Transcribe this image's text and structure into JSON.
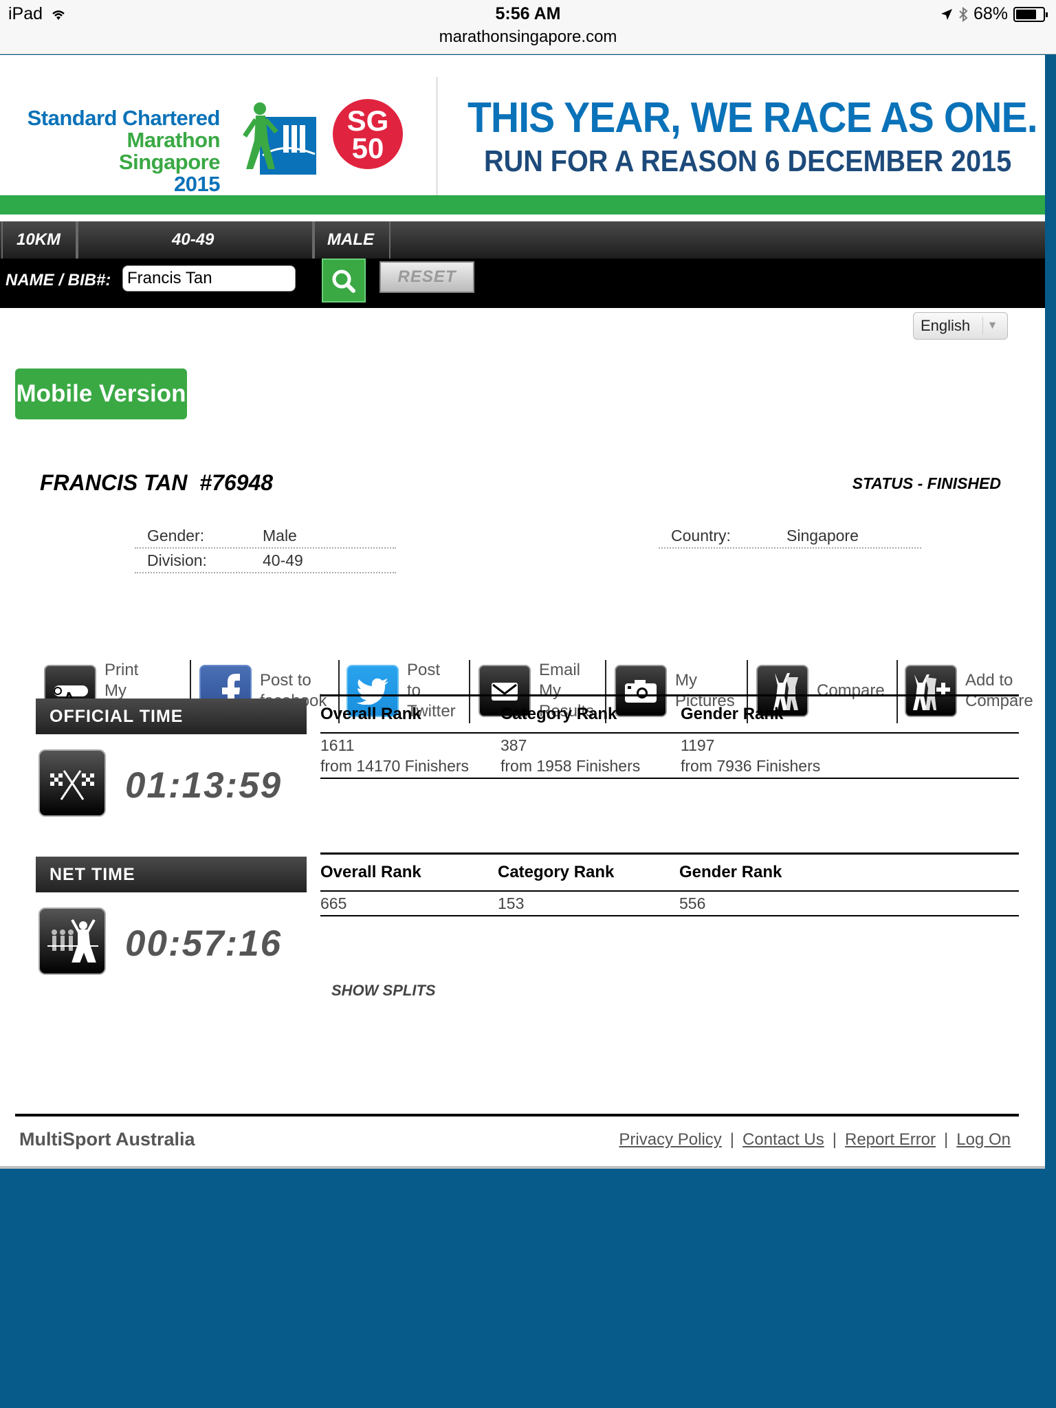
{
  "status_bar": {
    "device": "iPad",
    "time": "5:56 AM",
    "url": "marathonsingapore.com",
    "battery": "68%"
  },
  "banner": {
    "logo_line1": "Standard Chartered",
    "logo_line2": "Marathon Singapore",
    "logo_line3": "2015",
    "badge_line1": "SG",
    "badge_line2": "50",
    "slogan_line1": "THIS YEAR, WE RACE AS ONE.",
    "slogan_line2": "RUN FOR A REASON  6 DECEMBER 2015"
  },
  "filters": {
    "distance": "10KM",
    "age_group": "40-49",
    "gender": "MALE"
  },
  "search": {
    "label": "NAME / BIB#:",
    "value": "Francis Tan",
    "reset_label": "RESET"
  },
  "language": {
    "selected": "English"
  },
  "mobile_version_label": "Mobile Version",
  "runner": {
    "name": "FRANCIS TAN  #76948",
    "status": "STATUS - FINISHED"
  },
  "info": {
    "gender_label": "Gender:",
    "gender_value": "Male",
    "division_label": "Division:",
    "division_value": "40-49",
    "country_label": "Country:",
    "country_value": "Singapore"
  },
  "actions": [
    {
      "label": "Print\nMy\nCertificate",
      "icon": "certificate-icon"
    },
    {
      "label": "Post to\nfacebook",
      "icon": "facebook-icon"
    },
    {
      "label": "Post\nto\nTwitter",
      "icon": "twitter-icon"
    },
    {
      "label": "Email\nMy\nResults",
      "icon": "email-icon"
    },
    {
      "label": "My\nPictures",
      "icon": "camera-icon"
    },
    {
      "label": "Compare",
      "icon": "compare-icon"
    },
    {
      "label": "Add to\nCompare",
      "icon": "add-compare-icon"
    }
  ],
  "official": {
    "label": "OFFICIAL TIME",
    "time": "01:13:59",
    "headers": [
      "Overall Rank",
      "Category Rank",
      "Gender Rank"
    ],
    "ranks": [
      "1611",
      "387",
      "1197"
    ],
    "from": [
      "from 14170 Finishers",
      "from 1958 Finishers",
      "from 7936 Finishers"
    ]
  },
  "net": {
    "label": "NET TIME",
    "time": "00:57:16",
    "headers": [
      "Overall Rank",
      "Category Rank",
      "Gender Rank"
    ],
    "ranks": [
      "665",
      "153",
      "556"
    ]
  },
  "show_splits": "SHOW SPLITS",
  "footer": {
    "brand": "MultiSport Australia",
    "links": [
      "Privacy Policy",
      "Contact Us",
      "Report Error",
      "Log On"
    ]
  },
  "colors": {
    "green": "#3aa944",
    "blue": "#0a72b8",
    "bg_blue": "#065b8a",
    "red": "#e0243f"
  }
}
